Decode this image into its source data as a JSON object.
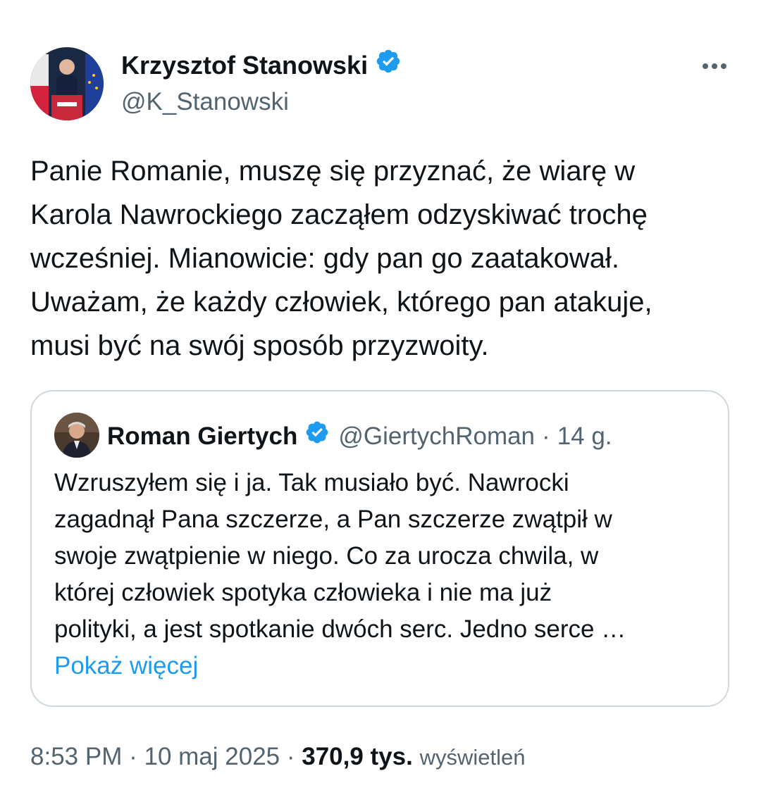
{
  "tweet": {
    "author": {
      "name": "Krzysztof Stanowski",
      "handle": "@K_Stanowski"
    },
    "text": "Panie Romanie, muszę się przyznać, że wiarę w\nKarola Nawrockiego zacząłem odzyskiwać trochę\nwcześniej. Mianowicie: gdy pan go zaatakował.\nUważam, że każdy człowiek, którego pan atakuje,\nmusi być na swój sposób przyzwoity.",
    "more_icon": "more-dots-icon",
    "verified_icon": "verified-badge-icon"
  },
  "quote": {
    "author": {
      "name": "Roman Giertych",
      "handle": "@GiertychRoman"
    },
    "separator": "·",
    "time": "14 g.",
    "text": "Wzruszyłem się i ja. Tak musiało być. Nawrocki\nzagadnął Pana szczerze, a Pan szczerze zwątpił w\nswoje zwątpienie w niego. Co za urocza chwila, w\nktórej człowiek spotyka człowieka i nie ma już\npolityki, a jest spotkanie dwóch serc. Jedno serce …",
    "show_more": "Pokaż więcej"
  },
  "meta": {
    "time": "8:53 PM",
    "separator": "·",
    "date": "10 maj 2025",
    "separator2": "·",
    "views_count": "370,9 tys.",
    "views_label": "wyświetleń"
  },
  "colors": {
    "text": "#0f1419",
    "secondary": "#536471",
    "link": "#1d9bf0",
    "border": "#cfd9de",
    "verified": "#1d9bf0"
  }
}
